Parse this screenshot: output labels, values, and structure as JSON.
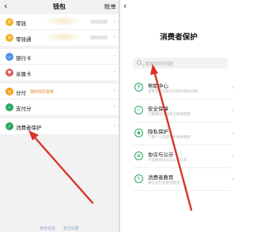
{
  "left": {
    "back": "‹",
    "title": "钱包",
    "header_right": "账单",
    "groups": [
      {
        "rows": [
          {
            "label": "零钱",
            "icon": "coin-icon",
            "color": "#f0b429",
            "glyph": "¥",
            "value": true
          },
          {
            "label": "零钱通",
            "icon": "coin-plus-icon",
            "color": "#f0b429",
            "glyph": "¥",
            "value": true
          }
        ]
      },
      {
        "rows": [
          {
            "label": "银行卡",
            "icon": "bank-card-icon",
            "color": "#4a90e2",
            "glyph": "▭"
          },
          {
            "label": "亲属卡",
            "icon": "family-card-icon",
            "color": "#e45a5a",
            "glyph": "♥"
          }
        ]
      },
      {
        "rows": [
          {
            "label": "分付",
            "icon": "installment-icon",
            "color": "#f39c12",
            "glyph": "分",
            "promo": "限时领优惠券"
          },
          {
            "label": "支付分",
            "icon": "pay-score-icon",
            "color": "#2aa862",
            "glyph": "✓"
          }
        ]
      },
      {
        "rows": [
          {
            "label": "消费者保护",
            "icon": "shield-icon",
            "color": "#2aa862",
            "glyph": "✓"
          }
        ]
      }
    ],
    "footer": [
      "身份信息",
      "支付设置"
    ]
  },
  "right": {
    "back": "‹",
    "title": "消费者保护",
    "search_placeholder": "搜索你的问题",
    "items": [
      {
        "title": "帮助中心",
        "subtitle": "查看常见问题与付款的相关说明",
        "icon": "help-icon",
        "glyph": "?"
      },
      {
        "title": "安全保障",
        "subtitle": "了解微信支付安全保障措施",
        "icon": "security-shield-icon",
        "glyph": "✓"
      },
      {
        "title": "隐私保护",
        "subtitle": "了解个人信息保护相关规则",
        "icon": "privacy-icon",
        "glyph": "◉"
      },
      {
        "title": "协议与公示",
        "subtitle": "产品服务协议与公示信息",
        "icon": "document-icon",
        "glyph": "≡"
      },
      {
        "title": "消费者教育",
        "subtitle": "微信支付消费者教育",
        "icon": "education-icon",
        "glyph": "✎"
      }
    ]
  },
  "annotation_color": "#d9342b"
}
